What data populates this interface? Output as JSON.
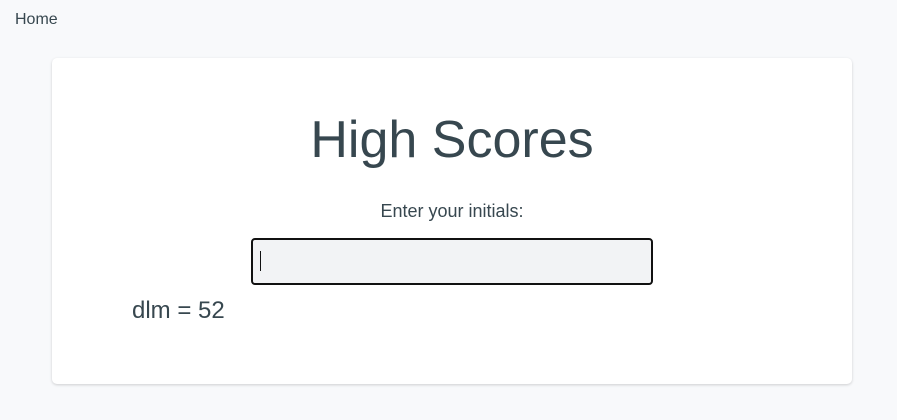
{
  "nav": {
    "home_label": "Home"
  },
  "main": {
    "title": "High Scores",
    "prompt": "Enter your initials:",
    "initials_input": {
      "value": "",
      "placeholder": ""
    },
    "scores": [
      {
        "text": "dlm = 52"
      }
    ]
  },
  "colors": {
    "background": "#f8f9fb",
    "card": "#ffffff",
    "text": "#37474f",
    "input_border": "#111111",
    "input_background": "#f2f3f5"
  }
}
